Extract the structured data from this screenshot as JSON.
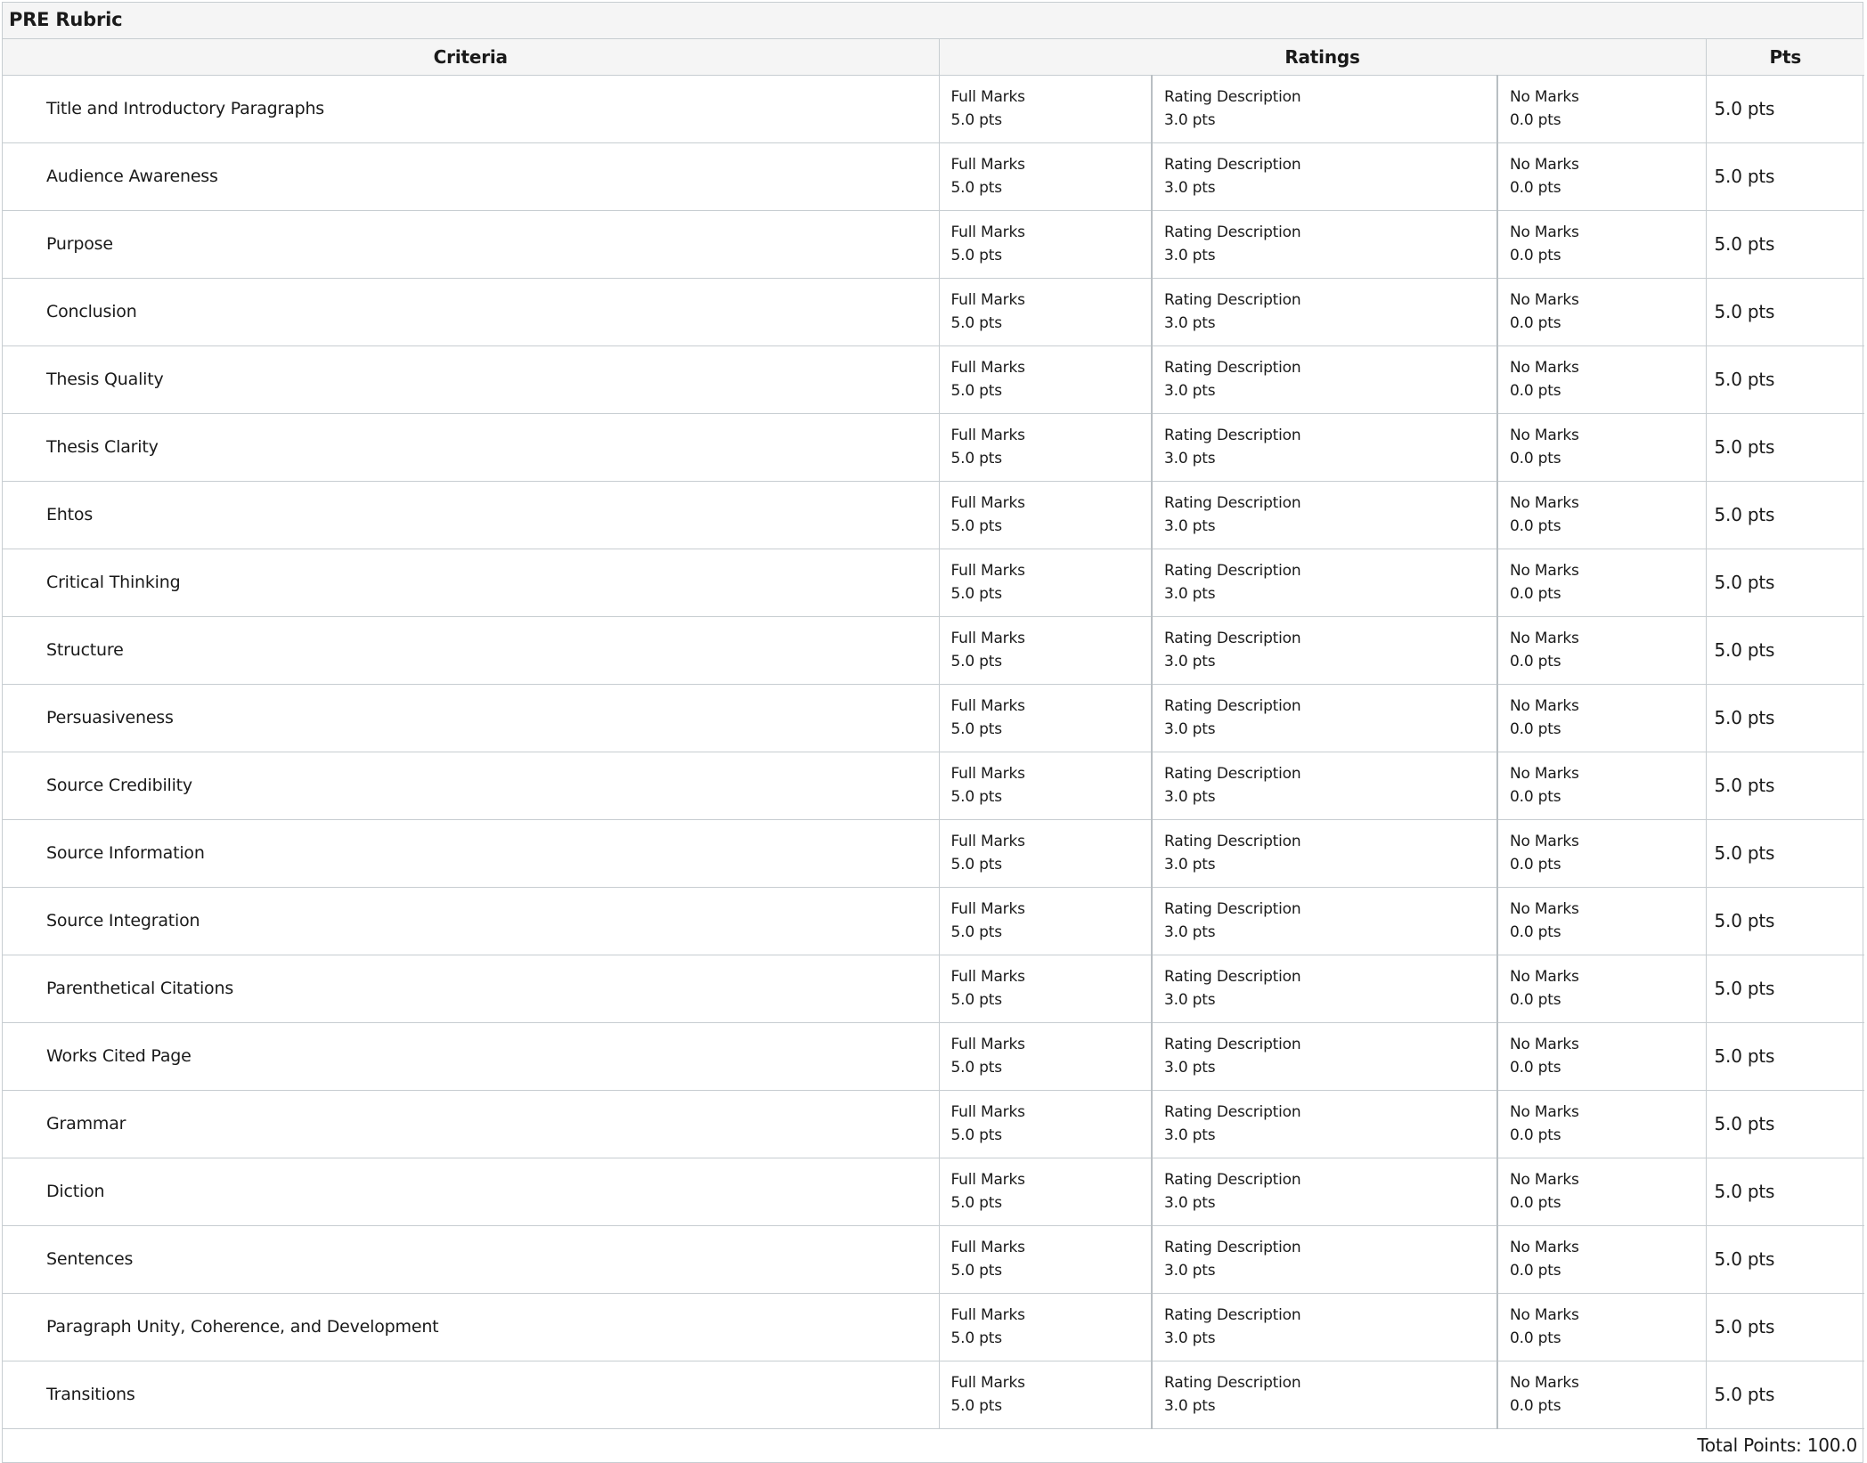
{
  "rubric": {
    "title": "PRE Rubric",
    "headers": {
      "criteria": "Criteria",
      "ratings": "Ratings",
      "pts": "Pts"
    },
    "rows": [
      {
        "criterion": "Title and Introductory Paragraphs",
        "r1_desc": "Full Marks",
        "r1_pts": "5.0 pts",
        "r2_desc": "Rating Description",
        "r2_pts": "3.0 pts",
        "r3_desc": "No Marks",
        "r3_pts": "0.0 pts",
        "pts": "5.0 pts"
      },
      {
        "criterion": "Audience Awareness",
        "r1_desc": "Full Marks",
        "r1_pts": "5.0 pts",
        "r2_desc": "Rating Description",
        "r2_pts": "3.0 pts",
        "r3_desc": "No Marks",
        "r3_pts": "0.0 pts",
        "pts": "5.0 pts"
      },
      {
        "criterion": "Purpose",
        "r1_desc": "Full Marks",
        "r1_pts": "5.0 pts",
        "r2_desc": "Rating Description",
        "r2_pts": "3.0 pts",
        "r3_desc": "No Marks",
        "r3_pts": "0.0 pts",
        "pts": "5.0 pts"
      },
      {
        "criterion": "Conclusion",
        "r1_desc": "Full Marks",
        "r1_pts": "5.0 pts",
        "r2_desc": "Rating Description",
        "r2_pts": "3.0 pts",
        "r3_desc": "No Marks",
        "r3_pts": "0.0 pts",
        "pts": "5.0 pts"
      },
      {
        "criterion": "Thesis Quality",
        "r1_desc": "Full Marks",
        "r1_pts": "5.0 pts",
        "r2_desc": "Rating Description",
        "r2_pts": "3.0 pts",
        "r3_desc": "No Marks",
        "r3_pts": "0.0 pts",
        "pts": "5.0 pts"
      },
      {
        "criterion": "Thesis Clarity",
        "r1_desc": "Full Marks",
        "r1_pts": "5.0 pts",
        "r2_desc": "Rating Description",
        "r2_pts": "3.0 pts",
        "r3_desc": "No Marks",
        "r3_pts": "0.0 pts",
        "pts": "5.0 pts"
      },
      {
        "criterion": "Ehtos",
        "r1_desc": "Full Marks",
        "r1_pts": "5.0 pts",
        "r2_desc": "Rating Description",
        "r2_pts": "3.0 pts",
        "r3_desc": "No Marks",
        "r3_pts": "0.0 pts",
        "pts": "5.0 pts"
      },
      {
        "criterion": "Critical Thinking",
        "r1_desc": "Full Marks",
        "r1_pts": "5.0 pts",
        "r2_desc": "Rating Description",
        "r2_pts": "3.0 pts",
        "r3_desc": "No Marks",
        "r3_pts": "0.0 pts",
        "pts": "5.0 pts"
      },
      {
        "criterion": "Structure",
        "r1_desc": "Full Marks",
        "r1_pts": "5.0 pts",
        "r2_desc": "Rating Description",
        "r2_pts": "3.0 pts",
        "r3_desc": "No Marks",
        "r3_pts": "0.0 pts",
        "pts": "5.0 pts"
      },
      {
        "criterion": "Persuasiveness",
        "r1_desc": "Full Marks",
        "r1_pts": "5.0 pts",
        "r2_desc": "Rating Description",
        "r2_pts": "3.0 pts",
        "r3_desc": "No Marks",
        "r3_pts": "0.0 pts",
        "pts": "5.0 pts"
      },
      {
        "criterion": "Source Credibility",
        "r1_desc": "Full Marks",
        "r1_pts": "5.0 pts",
        "r2_desc": "Rating Description",
        "r2_pts": "3.0 pts",
        "r3_desc": "No Marks",
        "r3_pts": "0.0 pts",
        "pts": "5.0 pts"
      },
      {
        "criterion": "Source Information",
        "r1_desc": "Full Marks",
        "r1_pts": "5.0 pts",
        "r2_desc": "Rating Description",
        "r2_pts": "3.0 pts",
        "r3_desc": "No Marks",
        "r3_pts": "0.0 pts",
        "pts": "5.0 pts"
      },
      {
        "criterion": "Source Integration",
        "r1_desc": "Full Marks",
        "r1_pts": "5.0 pts",
        "r2_desc": "Rating Description",
        "r2_pts": "3.0 pts",
        "r3_desc": "No Marks",
        "r3_pts": "0.0 pts",
        "pts": "5.0 pts"
      },
      {
        "criterion": "Parenthetical Citations",
        "r1_desc": "Full Marks",
        "r1_pts": "5.0 pts",
        "r2_desc": "Rating Description",
        "r2_pts": "3.0 pts",
        "r3_desc": "No Marks",
        "r3_pts": "0.0 pts",
        "pts": "5.0 pts"
      },
      {
        "criterion": "Works Cited Page",
        "r1_desc": "Full Marks",
        "r1_pts": "5.0 pts",
        "r2_desc": "Rating Description",
        "r2_pts": "3.0 pts",
        "r3_desc": "No Marks",
        "r3_pts": "0.0 pts",
        "pts": "5.0 pts"
      },
      {
        "criterion": "Grammar",
        "r1_desc": "Full Marks",
        "r1_pts": "5.0 pts",
        "r2_desc": "Rating Description",
        "r2_pts": "3.0 pts",
        "r3_desc": "No Marks",
        "r3_pts": "0.0 pts",
        "pts": "5.0 pts"
      },
      {
        "criterion": "Diction",
        "r1_desc": "Full Marks",
        "r1_pts": "5.0 pts",
        "r2_desc": "Rating Description",
        "r2_pts": "3.0 pts",
        "r3_desc": "No Marks",
        "r3_pts": "0.0 pts",
        "pts": "5.0 pts"
      },
      {
        "criterion": "Sentences",
        "r1_desc": "Full Marks",
        "r1_pts": "5.0 pts",
        "r2_desc": "Rating Description",
        "r2_pts": "3.0 pts",
        "r3_desc": "No Marks",
        "r3_pts": "0.0 pts",
        "pts": "5.0 pts"
      },
      {
        "criterion": "Paragraph Unity, Coherence, and Development",
        "r1_desc": "Full Marks",
        "r1_pts": "5.0 pts",
        "r2_desc": "Rating Description",
        "r2_pts": "3.0 pts",
        "r3_desc": "No Marks",
        "r3_pts": "0.0 pts",
        "pts": "5.0 pts"
      },
      {
        "criterion": "Transitions",
        "r1_desc": "Full Marks",
        "r1_pts": "5.0 pts",
        "r2_desc": "Rating Description",
        "r2_pts": "3.0 pts",
        "r3_desc": "No Marks",
        "r3_pts": "0.0 pts",
        "pts": "5.0 pts"
      }
    ],
    "total": "Total Points: 100.0"
  }
}
